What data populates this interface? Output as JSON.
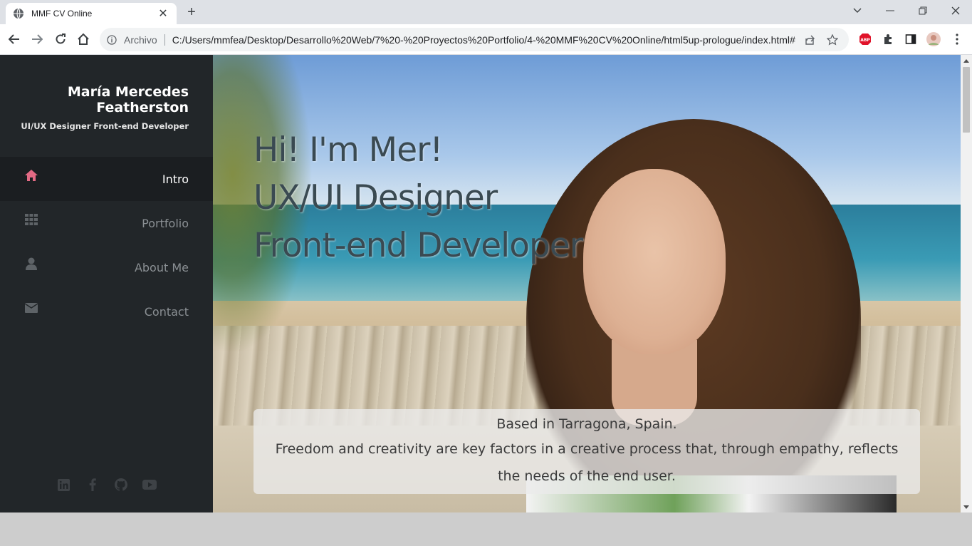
{
  "browser": {
    "tab_title": "MMF CV Online",
    "tab_close": "✕",
    "new_tab": "+",
    "url_scheme": "Archivo",
    "url": "C:/Users/mmfea/Desktop/Desarrollo%20Web/7%20-%20Proyectos%20Portfolio/4-%20MMF%20CV%20Online/html5up-prologue/index.html#..."
  },
  "sidebar": {
    "name": "María Mercedes Featherston",
    "subtitle": "UI/UX Designer Front-end Developer",
    "nav": [
      {
        "label": "Intro",
        "icon": "home-icon",
        "active": true
      },
      {
        "label": "Portfolio",
        "icon": "grid-icon",
        "active": false
      },
      {
        "label": "About Me",
        "icon": "user-icon",
        "active": false
      },
      {
        "label": "Contact",
        "icon": "envelope-icon",
        "active": false
      }
    ],
    "social": [
      "linkedin-icon",
      "facebook-icon",
      "github-icon",
      "youtube-icon"
    ]
  },
  "hero": {
    "line1": "Hi! I'm Mer!",
    "line2": "UX/UI Designer",
    "line3": "Front-end Developer",
    "location": "Based in Tarragona, Spain.",
    "description": "Freedom and creativity are key factors in a creative process that, through empathy, reflects the needs of the end user."
  },
  "colors": {
    "sidebar_bg": "#222629",
    "active_icon": "#e36a84",
    "muted": "#6b7075"
  }
}
